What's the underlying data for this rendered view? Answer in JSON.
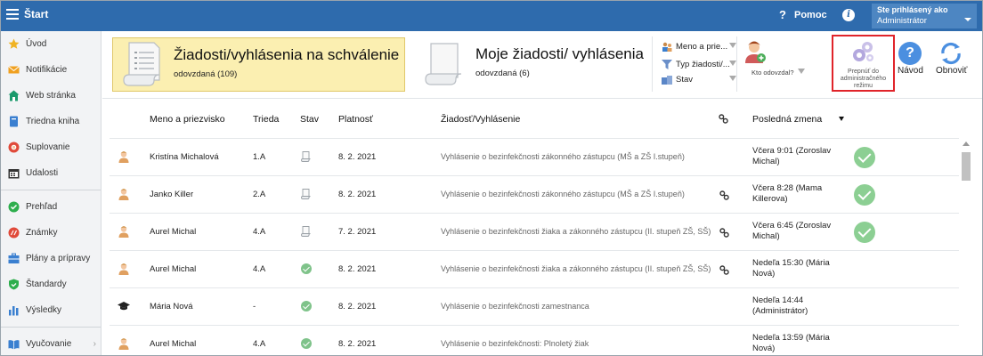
{
  "topbar": {
    "title": "Štart",
    "help_label": "Pomoc",
    "help_icon": "?",
    "info_icon": "i",
    "user_title": "Ste prihlásený ako",
    "user_role": "Administrátor"
  },
  "sidebar": {
    "items": [
      {
        "label": "Úvod",
        "icon": "star-icon",
        "color": "#f0b323"
      },
      {
        "label": "Notifikácie",
        "icon": "envelope-icon",
        "color": "#f0a020"
      },
      {
        "label": "Web stránka",
        "icon": "home-icon",
        "color": "#1a9a6c"
      },
      {
        "label": "Triedna kniha",
        "icon": "book-icon",
        "color": "#3a7fd0"
      },
      {
        "label": "Suplovanie",
        "icon": "lifebuoy-icon",
        "color": "#e04a3a"
      },
      {
        "label": "Udalosti",
        "icon": "calendar-icon",
        "color": "#333333"
      },
      {
        "label": "Prehľad",
        "icon": "check-circle-icon",
        "color": "#2eae4d"
      },
      {
        "label": "Známky",
        "icon": "grades-icon",
        "color": "#e04a3a"
      },
      {
        "label": "Plány a prípravy",
        "icon": "briefcase-icon",
        "color": "#3a7fd0"
      },
      {
        "label": "Štandardy",
        "icon": "shield-icon",
        "color": "#2eae4d"
      },
      {
        "label": "Výsledky",
        "icon": "bar-chart-icon",
        "color": "#3a7fd0"
      },
      {
        "label": "Vyučovanie",
        "icon": "open-book-icon",
        "color": "#3a7fd0"
      }
    ]
  },
  "toolbar": {
    "tile_active": {
      "title": "Žiadosti/vyhlásenia na schválenie",
      "subtitle": "odovzdaná (109)"
    },
    "tile_other": {
      "title": "Moje žiadosti/ vyhlásenia",
      "subtitle": "odovzdaná (6)"
    },
    "filters": [
      {
        "label": "Meno a prie...",
        "icon": "people-icon"
      },
      {
        "label": "Typ žiadosti/...",
        "icon": "funnel-icon"
      },
      {
        "label": "Stav",
        "icon": "status-icon"
      }
    ],
    "who_label": "Kto odovzdal?",
    "admin_label": "Prepnúť do administračného režimu",
    "navod_label": "Návod",
    "refresh_label": "Obnoviť"
  },
  "table": {
    "headers": {
      "name": "Meno a priezvisko",
      "class": "Trieda",
      "status": "Stav",
      "validity": "Platnosť",
      "request": "Žiadosť/Vyhlásenie",
      "last_change": "Posledná zmena"
    },
    "rows": [
      {
        "avatar": "person-icon",
        "name": "Kristína Michalová",
        "class": "1.A",
        "status": "document",
        "validity": "8. 2. 2021",
        "request": "Vyhlásenie o bezinfekčnosti zákonného zástupcu (MŠ a ZŠ I.stupeň)",
        "link": false,
        "last": "Včera 9:01 (Zoroslav Michal)",
        "approved": true
      },
      {
        "avatar": "person-icon",
        "name": "Janko Killer",
        "class": "2.A",
        "status": "document",
        "validity": "8. 2. 2021",
        "request": "Vyhlásenie o bezinfekčnosti zákonného zástupcu (MŠ a ZŠ I.stupeň)",
        "link": true,
        "last": "Včera 8:28 (Mama Killerova)",
        "approved": true
      },
      {
        "avatar": "person-icon",
        "name": "Aurel Michal",
        "class": "4.A",
        "status": "document",
        "validity": "7. 2. 2021",
        "request": "Vyhlásenie o bezinfekčnosti žiaka a zákonného zástupcu (II. stupeň ZŠ, SŠ)",
        "link": true,
        "last": "Včera 6:45 (Zoroslav Michal)",
        "approved": true
      },
      {
        "avatar": "person-icon",
        "name": "Aurel Michal",
        "class": "4.A",
        "status": "ok",
        "validity": "8. 2. 2021",
        "request": "Vyhlásenie o bezinfekčnosti žiaka a zákonného zástupcu (II. stupeň ZŠ, SŠ)",
        "link": true,
        "last": "Nedeľa 15:30 (Mária Nová)",
        "approved": false
      },
      {
        "avatar": "graduation-cap-icon",
        "name": "Mária Nová",
        "class": "-",
        "status": "ok",
        "validity": "8. 2. 2021",
        "request": "Vyhlásenie o bezinfekčnosti zamestnanca",
        "link": false,
        "last": "Nedeľa 14:44 (Administrátor)",
        "approved": false
      },
      {
        "avatar": "person-icon",
        "name": "Aurel Michal",
        "class": "4.A",
        "status": "ok",
        "validity": "8. 2. 2021",
        "request": "Vyhlásenie o bezinfekčnosti: Plnoletý žiak",
        "link": false,
        "last": "Nedeľa 13:59 (Mária Nová)",
        "approved": false
      }
    ]
  }
}
